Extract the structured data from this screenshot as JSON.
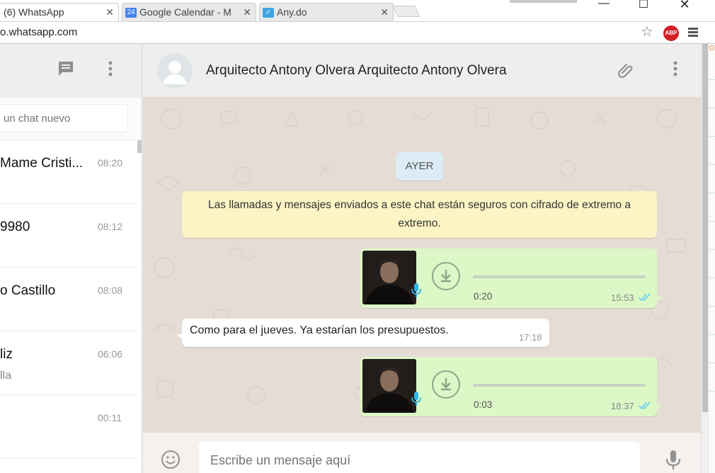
{
  "browser": {
    "tabs": [
      {
        "title": "(6) WhatsApp",
        "close": "✕"
      },
      {
        "title": "Google Calendar - M",
        "close": "✕",
        "favicon_text": "24",
        "favicon_color": "#4285f4"
      },
      {
        "title": "Any.do",
        "close": "✕",
        "favicon_text": "✓",
        "favicon_color": "#3fa7e0"
      }
    ],
    "url": "o.whatsapp.com",
    "abp_label": "ABP"
  },
  "sidebar": {
    "search_placeholder": "un chat nuevo",
    "chats": [
      {
        "name": "Mame Cristi...",
        "time": "08:20",
        "preview": ""
      },
      {
        "name": "9980",
        "time": "08:12",
        "preview": ""
      },
      {
        "name": "o Castillo",
        "time": "08:08",
        "preview": ""
      },
      {
        "name": "liz",
        "time": "06:06",
        "preview": "lla"
      },
      {
        "name": "",
        "time": "00:11",
        "preview": ""
      }
    ]
  },
  "chat": {
    "contact_name": "Arquitecto Antony Olvera Arquitecto Antony Olvera",
    "day_label": "AYER",
    "encryption_notice": "Las llamadas y mensajes enviados a este chat están seguros con cifrado de extremo a extremo.",
    "messages": [
      {
        "type": "voice",
        "direction": "out",
        "duration": "0:20",
        "time": "15:53",
        "progress": 0
      },
      {
        "type": "text",
        "direction": "in",
        "text": "Como para el jueves. Ya estarían los presupuestos.",
        "time": "17:18"
      },
      {
        "type": "voice",
        "direction": "out",
        "duration": "0:03",
        "time": "18:37",
        "progress": 0
      }
    ],
    "composer_placeholder": "Escribe un mensaje aquí"
  },
  "colors": {
    "outgoing_bubble": "#dcf8c6",
    "incoming_bubble": "#ffffff",
    "read_ticks": "#4fc3f7",
    "wallpaper": "#e5ddd5",
    "mic_badge": "#2bb6e6"
  },
  "icons": [
    "new-chat-icon",
    "kebab-menu-icon",
    "default-avatar-icon",
    "paperclip-icon",
    "download-icon",
    "microphone-icon",
    "emoji-icon",
    "double-check-icon",
    "star-icon",
    "adblock-icon",
    "browser-menu-icon"
  ]
}
